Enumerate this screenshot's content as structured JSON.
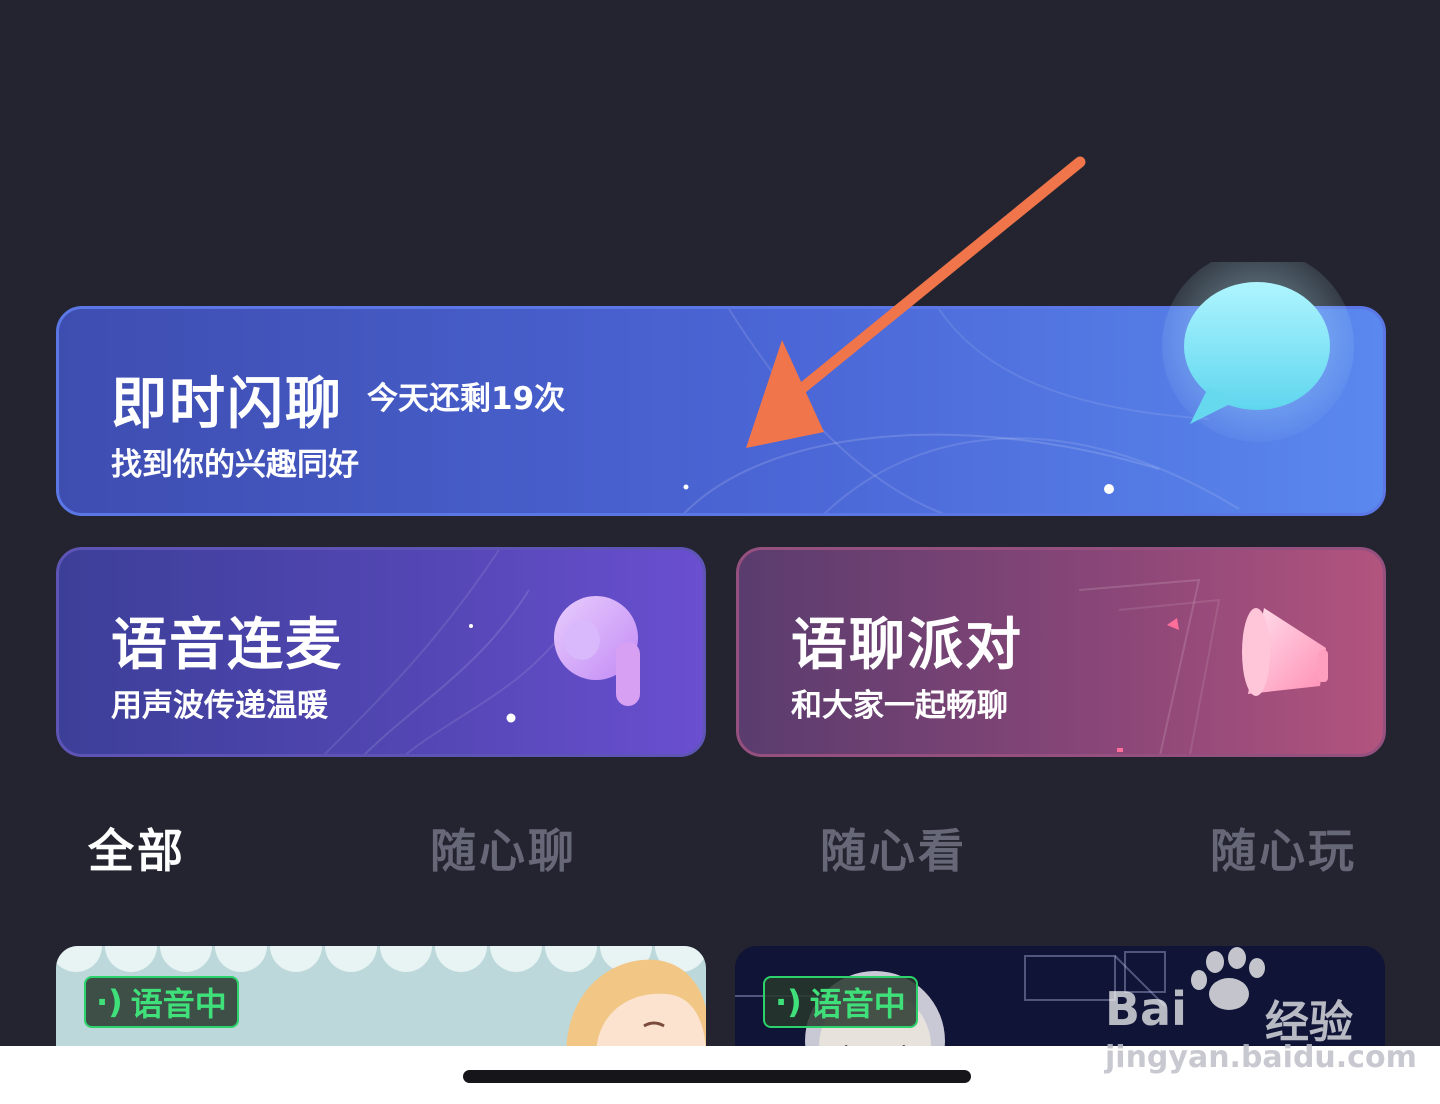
{
  "flash_chat": {
    "title": "即时闪聊",
    "remaining": "今天还剩19次",
    "subtitle": "找到你的兴趣同好",
    "icon": "chat-bubble-icon"
  },
  "voice_mic": {
    "title": "语音连麦",
    "subtitle": "用声波传递温暖",
    "icon": "earbud-icon"
  },
  "voice_party": {
    "title": "语聊派对",
    "subtitle": "和大家一起畅聊",
    "icon": "megaphone-icon"
  },
  "tabs": [
    {
      "label": "全部",
      "active": true
    },
    {
      "label": "随心聊",
      "active": false
    },
    {
      "label": "随心看",
      "active": false
    },
    {
      "label": "随心玩",
      "active": false
    }
  ],
  "rooms": [
    {
      "badge": "语音中"
    },
    {
      "badge": "语音中"
    }
  ],
  "watermark": {
    "brand": "Bai",
    "brand_cn": "经验",
    "url": "jingyan.baidu.com"
  },
  "annotation": {
    "color": "#f0754a",
    "icon": "arrow-icon"
  },
  "colors": {
    "background": "#23242f",
    "flash_card": "#4b66d6",
    "voice_card": "#5547b6",
    "party_card": "#8c4778",
    "badge_green": "#3fe07a"
  }
}
